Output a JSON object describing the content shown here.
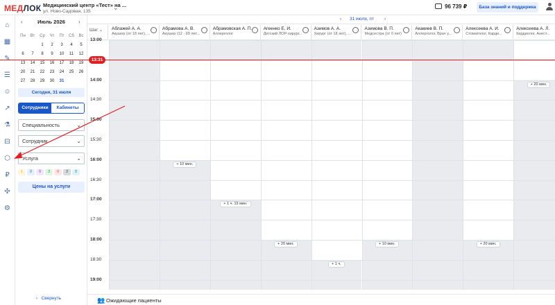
{
  "header": {
    "logo_a": "МЕД",
    "logo_b": "ЛОК",
    "clinic_name": "Медицинский центр «Тест» на ...",
    "clinic_address": "ул. Ново-Садовая, 135",
    "balance": "96 739 ₽",
    "kb_button": "База знаний и поддержка"
  },
  "calendar": {
    "month": "Июль 2026",
    "weekdays": [
      "Пн",
      "Вт",
      "Ср",
      "Чт",
      "Пт",
      "Сб",
      "Вс"
    ],
    "weeks": [
      [
        "",
        "",
        "1",
        "2",
        "3",
        "4",
        "5"
      ],
      [
        "6",
        "7",
        "8",
        "9",
        "10",
        "11",
        "12"
      ],
      [
        "13",
        "14",
        "15",
        "16",
        "17",
        "18",
        "19"
      ],
      [
        "20",
        "21",
        "22",
        "23",
        "24",
        "25",
        "26"
      ],
      [
        "27",
        "28",
        "29",
        "30",
        "31",
        "",
        ""
      ]
    ],
    "today_label": "Сегодня, 31 июля"
  },
  "filters": {
    "seg_active": "Сотрудники",
    "seg_inactive": "Кабинеты",
    "specialty_placeholder": "Специальность",
    "employee_placeholder": "Сотрудник",
    "service_placeholder": "Услуга",
    "counters": [
      {
        "value": "1",
        "color": "#f6a821",
        "bg": "#fff4dc"
      },
      {
        "value": "0",
        "color": "#2f6fd0",
        "bg": "#e5efff"
      },
      {
        "value": "0",
        "color": "#8e44ad",
        "bg": "#f3e6fb"
      },
      {
        "value": "3",
        "color": "#2ea043",
        "bg": "#e1f5e6"
      },
      {
        "value": "0",
        "color": "#e05050",
        "bg": "#fde6e6"
      },
      {
        "value": "2",
        "color": "#444444",
        "bg": "#d6dbe0"
      },
      {
        "value": "0",
        "color": "#1a7f8a",
        "bg": "#e0f3f5"
      }
    ],
    "prices_button": "Цены на услуги",
    "collapse_label": "Свернуть"
  },
  "schedule": {
    "date_label": "31 июля, пт",
    "step_label": "Шаг",
    "now_time": "13:31",
    "times": [
      "13:00",
      "13:30",
      "14:00",
      "14:30",
      "15:00",
      "15:30",
      "16:00",
      "16:30",
      "17:00",
      "17:30",
      "18:00",
      "18:30",
      "19:00"
    ],
    "doctors": [
      {
        "name": "Аблажей А. А.",
        "spec": "Акушер (от 18 лет), ..."
      },
      {
        "name": "Абрамова А. В.",
        "spec": "Акушер (12 - 99 лет..."
      },
      {
        "name": "Абрамовская А. П.",
        "spec": "Аллерголог"
      },
      {
        "name": "Агеенко Е. И.",
        "spec": "Детский ЛОР-хирург..."
      },
      {
        "name": "Азимов А. А.",
        "spec": "Хирург (от 18 лет), ..."
      },
      {
        "name": "Азимова В. П.",
        "spec": "Медсестра (от 0 лет)"
      },
      {
        "name": "Акакиев В. П.",
        "spec": "Аллерголог, Врач у..."
      },
      {
        "name": "Алексеева А. И.",
        "spec": "Стоматолог, Карди..."
      },
      {
        "name": "Алексеева А. Л.",
        "spec": "Кардиолог, Анест..."
      }
    ],
    "chips": [
      {
        "text": "+ 10 мин.",
        "col": 1,
        "row": 6
      },
      {
        "text": "+ 1 ч. 15 мин.",
        "col": 2,
        "row": 8
      },
      {
        "text": "+ 20 мин.",
        "col": 3,
        "row": 10
      },
      {
        "text": "+ 1 ч.",
        "col": 4,
        "row": 11
      },
      {
        "text": "+ 10 мин.",
        "col": 5,
        "row": 10
      },
      {
        "text": "+ 20 мин.",
        "col": 7,
        "row": 10
      },
      {
        "text": "+ 20 мин.",
        "col": 8,
        "row": 2
      }
    ],
    "waiting_label": "Ожидающие пациенты"
  }
}
